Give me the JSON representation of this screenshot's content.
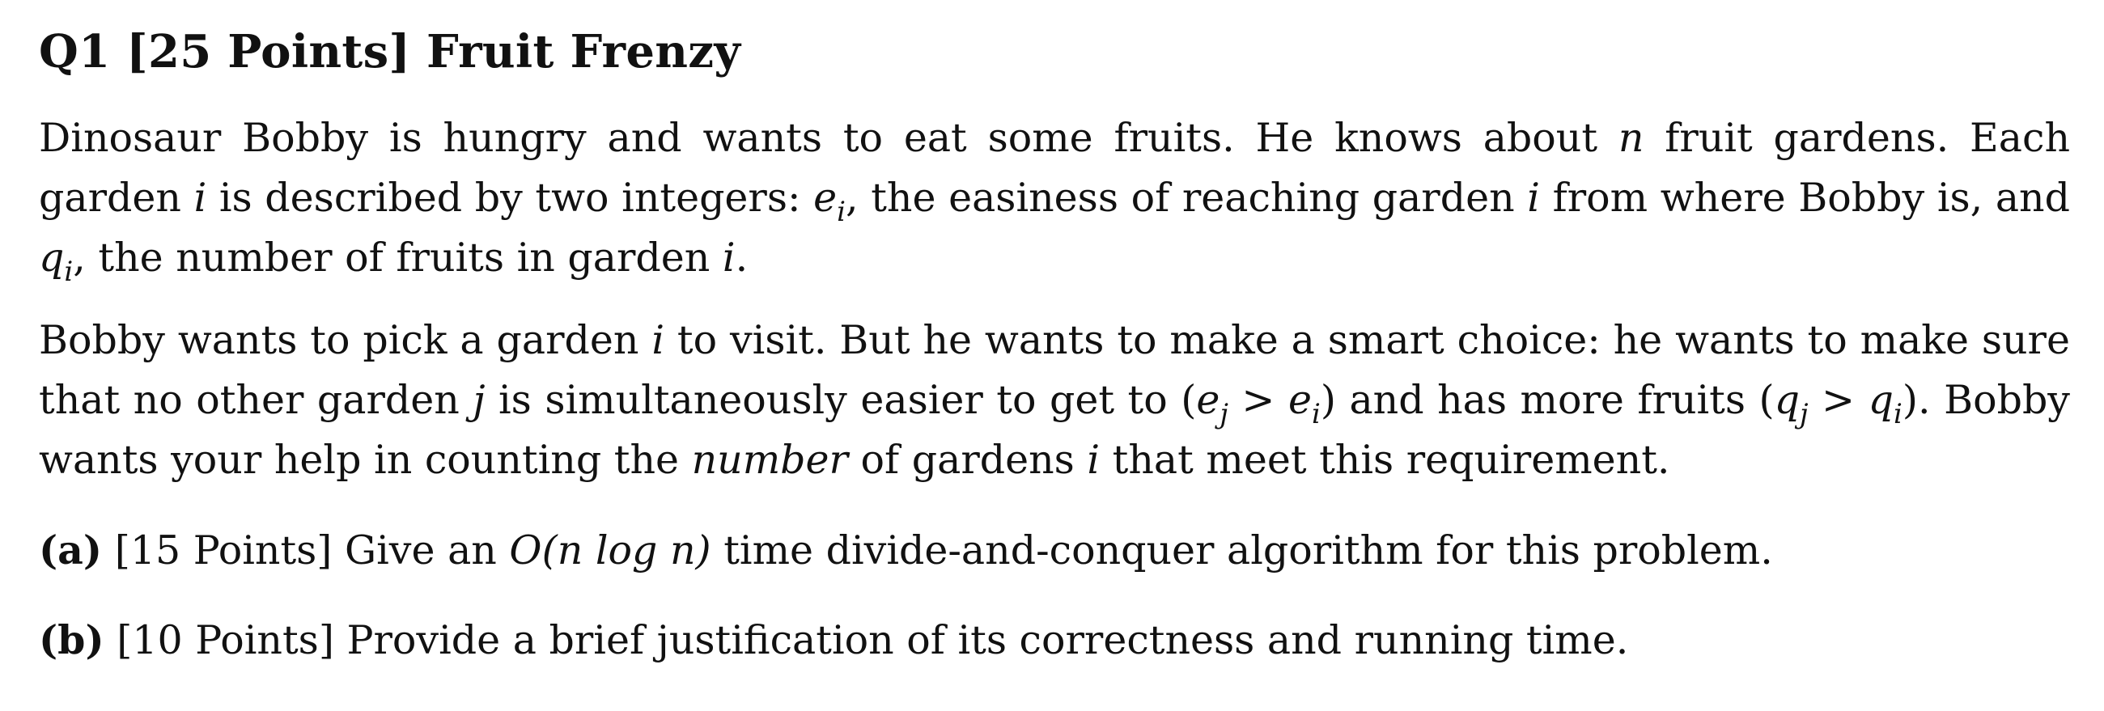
{
  "question": {
    "number": "Q1",
    "points": "[25 Points]",
    "title": "Fruit Frenzy"
  },
  "para1": {
    "t1": "Dinosaur Bobby is hungry and wants to eat some fruits. He knows about ",
    "n": "n",
    "t2": " fruit gardens. Each garden ",
    "i1": "i",
    "t3": " is described by two integers: ",
    "e": "e",
    "e_sub": "i",
    "t4": ", the easiness of reaching garden ",
    "i2": "i",
    "t5": " from where Bobby is, and ",
    "q": "q",
    "q_sub": "i",
    "t6": ", the number of fruits in garden ",
    "i3": "i",
    "t7": "."
  },
  "para2": {
    "t1": "Bobby wants to pick a garden ",
    "i1": "i",
    "t2": " to visit. But he wants to make a smart choice: he wants to make sure that no other garden ",
    "j": "j",
    "t3": " is simultaneously easier to get to (",
    "ej": "e",
    "ej_sub": "j",
    "gt1": " > ",
    "ei": "e",
    "ei_sub": "i",
    "t4": ") and has more fruits (",
    "qj": "q",
    "qj_sub": "j",
    "gt2": " > ",
    "qi": "q",
    "qi_sub": "i",
    "t5": "). Bobby wants your help in counting the ",
    "emph": "number",
    "t6": " of gardens ",
    "i2": "i",
    "t7": " that meet this requirement."
  },
  "parts": [
    {
      "label": "(a)",
      "points": "[15 Points]",
      "t1": " Give an ",
      "math": "O(n log n)",
      "t2": " time divide-and-conquer algorithm for this problem."
    },
    {
      "label": "(b)",
      "points": "[10 Points]",
      "t1": " Provide a brief justification of its correctness and running time."
    }
  ]
}
